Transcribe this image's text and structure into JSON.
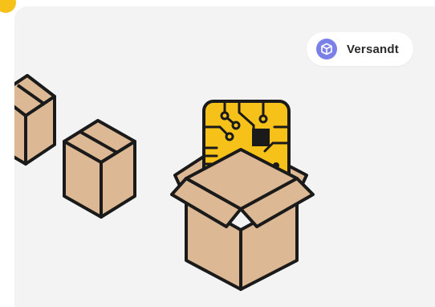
{
  "status_badge": {
    "label": "Versandt",
    "icon": "package-icon",
    "accent": "#7b7fe8"
  },
  "colors": {
    "card_background": "#f3f3f4",
    "box_fill": "#dcb994",
    "outline": "#1a1a1a",
    "chip_fill": "#f6c21a",
    "corner_accent": "#f6c21a"
  }
}
